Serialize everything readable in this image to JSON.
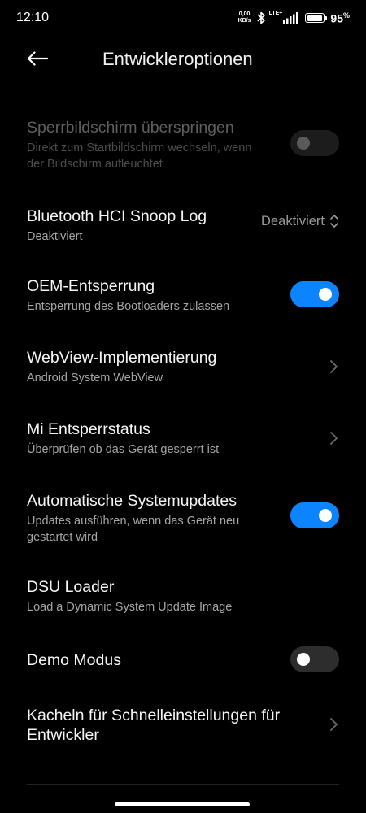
{
  "status_bar": {
    "time": "12:10",
    "net_speed_value": "0,00",
    "net_speed_unit": "KB/s",
    "network_type": "LTE+",
    "battery_percent": "95",
    "battery_level": 0.95,
    "icons": [
      "bluetooth-icon",
      "signal-icon",
      "battery-icon"
    ]
  },
  "header": {
    "title": "Entwickleroptionen",
    "back_icon": "arrow-left-icon"
  },
  "settings": [
    {
      "title": "Sperrbildschirm überspringen",
      "subtitle": "Direkt zum Startbildschirm wechseln, wenn der Bildschirm aufleuchtet",
      "control": "toggle",
      "state": "off",
      "enabled": false
    },
    {
      "title": "Bluetooth HCI Snoop Log",
      "subtitle": "Deaktiviert",
      "control": "select",
      "value": "Deaktiviert",
      "icon": "up-down-chevron-icon"
    },
    {
      "title": "OEM-Entsperrung",
      "subtitle": "Entsperrung des Bootloaders zulassen",
      "control": "toggle",
      "state": "on"
    },
    {
      "title": "WebView-Implementierung",
      "subtitle": "Android System WebView",
      "control": "chevron",
      "icon": "chevron-right-icon"
    },
    {
      "title": "Mi Entsperrstatus",
      "subtitle": "Überprüfen ob das Gerät gesperrt ist",
      "control": "chevron",
      "icon": "chevron-right-icon"
    },
    {
      "title": "Automatische Systemupdates",
      "subtitle": "Updates ausführen, wenn das Gerät neu gestartet wird",
      "control": "toggle",
      "state": "on"
    },
    {
      "title": "DSU Loader",
      "subtitle": "Load a Dynamic System Update Image",
      "control": "none"
    },
    {
      "title": "Demo Modus",
      "control": "toggle",
      "state": "off"
    },
    {
      "title": "Kacheln für Schnelleinstellungen für Entwickler",
      "control": "chevron",
      "icon": "chevron-right-icon"
    }
  ],
  "colors": {
    "background": "#000000",
    "accent": "#0d84ff",
    "toggle_off": "#2d2d2d"
  }
}
